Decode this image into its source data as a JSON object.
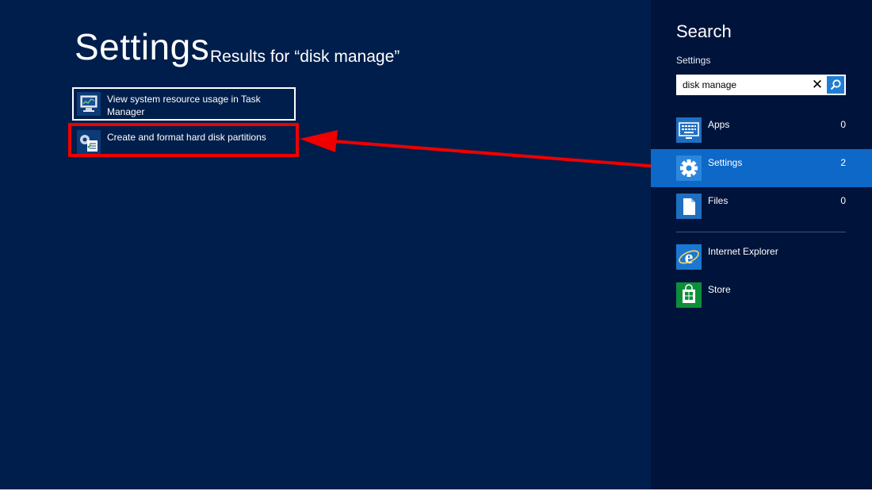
{
  "main": {
    "title": "Settings",
    "results_for": "Results for “disk manage”",
    "results": [
      {
        "label": "View system resource usage in Task Manager",
        "icon": "task-manager-icon"
      },
      {
        "label": "Create and format hard disk partitions",
        "icon": "disk-management-icon"
      }
    ]
  },
  "charm": {
    "title": "Search",
    "scope": "Settings",
    "search_value": "disk manage",
    "categories": [
      {
        "label": "Apps",
        "count": "0",
        "icon": "apps-icon"
      },
      {
        "label": "Settings",
        "count": "2",
        "icon": "gear-icon"
      },
      {
        "label": "Files",
        "count": "0",
        "icon": "file-icon"
      }
    ],
    "apps": [
      {
        "label": "Internet Explorer",
        "icon": "internet-explorer-icon"
      },
      {
        "label": "Store",
        "icon": "store-icon"
      }
    ]
  },
  "colors": {
    "background": "#001e4b",
    "charm_background": "#00143b",
    "selected_category": "#0d68c8",
    "annotation": "#ef0000"
  }
}
